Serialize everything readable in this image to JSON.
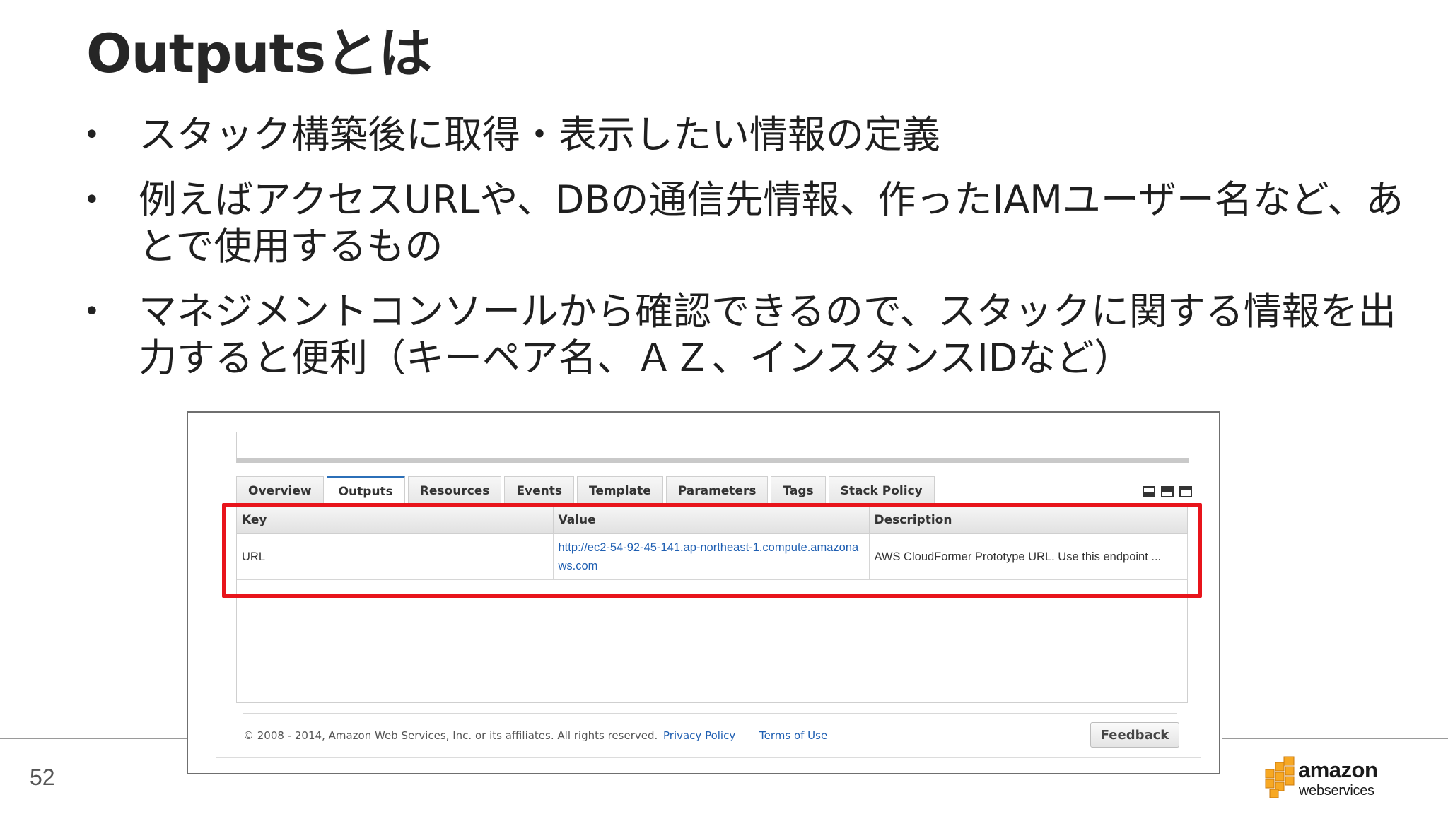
{
  "slide": {
    "title": "Outputsとは",
    "bullets": [
      "スタック構築後に取得・表示したい情報の定義",
      "例えばアクセスURLや、DBの通信先情報、作ったIAMユーザー名など、あとで使用するもの",
      "マネジメントコンソールから確認できるので、スタックに関する情報を出力すると便利（キーペア名、ＡＺ、インスタンスIDなど）"
    ],
    "bullet_glyph": "•",
    "page_number": "52",
    "logo": {
      "word1": "amazon",
      "word2": "webservices"
    }
  },
  "console": {
    "tabs": [
      {
        "label": "Overview",
        "active": false
      },
      {
        "label": "Outputs",
        "active": true
      },
      {
        "label": "Resources",
        "active": false
      },
      {
        "label": "Events",
        "active": false
      },
      {
        "label": "Template",
        "active": false
      },
      {
        "label": "Parameters",
        "active": false
      },
      {
        "label": "Tags",
        "active": false
      },
      {
        "label": "Stack Policy",
        "active": false
      }
    ],
    "table": {
      "headers": [
        "Key",
        "Value",
        "Description"
      ],
      "rows": [
        {
          "key": "URL",
          "value": "http://ec2-54-92-45-141.ap-northeast-1.compute.amazonaws.com",
          "description": "AWS CloudFormer Prototype URL. Use this endpoint ..."
        }
      ]
    },
    "footer": {
      "copyright": "© 2008 - 2014, Amazon Web Services, Inc. or its affiliates. All rights reserved.",
      "privacy": "Privacy Policy",
      "terms": "Terms of Use",
      "feedback": "Feedback"
    },
    "highlight_color": "#e8141b",
    "link_color": "#1f5fb2"
  }
}
